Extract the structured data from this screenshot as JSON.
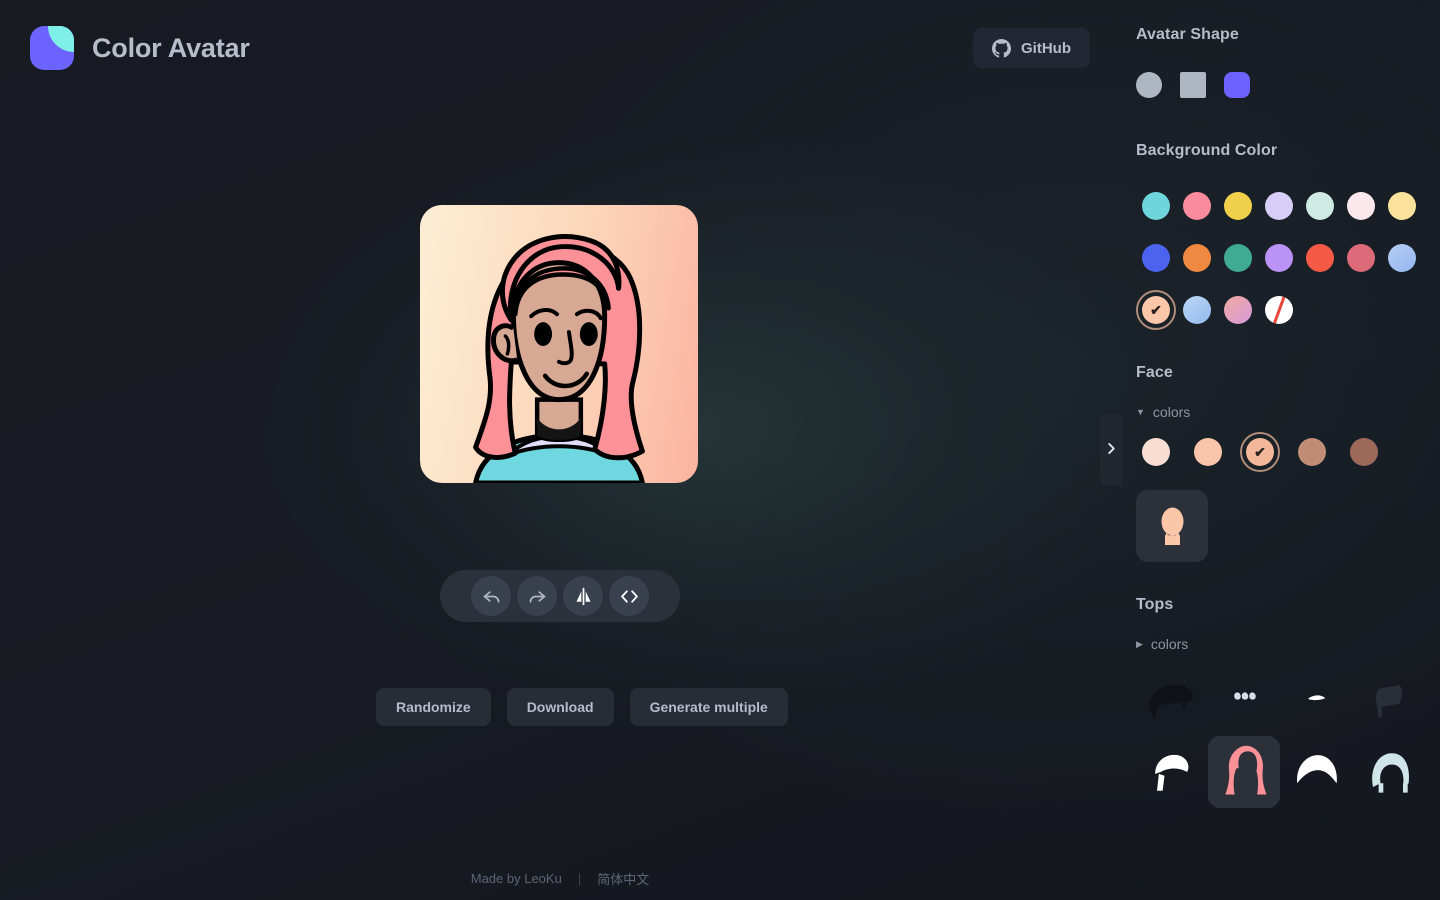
{
  "app": {
    "brand_title": "Color Avatar",
    "logo_colors": {
      "base": "#6c63ff",
      "accent": "#7ff0e8"
    },
    "background": "#16181f"
  },
  "header": {
    "github_label": "GitHub",
    "github_icon": "github-icon"
  },
  "stage": {
    "avatar": {
      "background_gradient_from": "#fdeed6",
      "background_gradient_to": "#fbb4a0",
      "hair_color": "#fc9298",
      "skin_color": "#d7a893",
      "top_color": "#6fd7e0",
      "collar_color": "#e3dcfb",
      "outline_color": "#000000"
    },
    "toolbar": [
      {
        "name": "undo-button",
        "icon": "undo-icon"
      },
      {
        "name": "redo-button",
        "icon": "redo-icon"
      },
      {
        "name": "flip-button",
        "icon": "flip-horizontal-icon"
      },
      {
        "name": "code-button",
        "icon": "code-icon"
      }
    ],
    "actions": [
      {
        "label": "Randomize",
        "name": "randomize-button"
      },
      {
        "label": "Download",
        "name": "download-button"
      },
      {
        "label": "Generate multiple",
        "name": "generate-multiple-button"
      }
    ]
  },
  "footer": {
    "made_by": "Made by LeoKu",
    "separator": "|",
    "language": "简体中文"
  },
  "sidebar": {
    "collapse_icon": "chevron-right-icon",
    "avatar_shape": {
      "title": "Avatar Shape",
      "options": [
        {
          "name": "shape-circle",
          "shape": "circle",
          "color": "#aeb6c2",
          "selected": false
        },
        {
          "name": "shape-square",
          "shape": "square",
          "color": "#aeb6c2",
          "selected": false
        },
        {
          "name": "shape-rounded",
          "shape": "rounded",
          "color": "#6c63ff",
          "selected": true
        }
      ]
    },
    "background_color": {
      "title": "Background Color",
      "swatches": [
        {
          "color": "#6dd5db",
          "selected": false
        },
        {
          "color": "#fa8b9c",
          "selected": false
        },
        {
          "color": "#f0cf4a",
          "selected": false
        },
        {
          "color": "#d7cdf7",
          "selected": false
        },
        {
          "color": "#cfe9e3",
          "selected": false
        },
        {
          "color": "#fbe8ec",
          "selected": false
        },
        {
          "color": "#fbe29a",
          "selected": false
        },
        {
          "color": "#4b63ef",
          "selected": false
        },
        {
          "color": "#ef8840",
          "selected": false
        },
        {
          "color": "#3fab93",
          "selected": false
        },
        {
          "color": "#bb92f5",
          "selected": false
        },
        {
          "color": "#f55a46",
          "selected": false
        },
        {
          "color": "#dc6a78",
          "selected": false
        },
        {
          "color": "#a9c0f2",
          "selected": false
        },
        {
          "color": "#fcc6a9",
          "selected": true
        },
        {
          "color": "#a8c8ee",
          "selected": false
        },
        {
          "color": "#e3a6d1",
          "selected": false
        },
        {
          "color": "none",
          "selected": false
        }
      ]
    },
    "face": {
      "title": "Face",
      "colors_label": "colors",
      "colors_expanded": true,
      "skin_swatches": [
        {
          "color": "#f8ddd0",
          "selected": false
        },
        {
          "color": "#fac5aa",
          "selected": false
        },
        {
          "color": "#f3b799",
          "selected": true
        },
        {
          "color": "#c08c75",
          "selected": false
        },
        {
          "color": "#9d6a5a",
          "selected": false
        }
      ],
      "thumbnails": [
        {
          "name": "face-shape-1",
          "selected": true,
          "color": "#fcc6a9"
        }
      ]
    },
    "tops": {
      "title": "Tops",
      "colors_label": "colors",
      "colors_expanded": false,
      "thumbnails": [
        {
          "name": "top-style-1",
          "selected": false,
          "color": "#101218",
          "style": "flat-dark"
        },
        {
          "name": "top-style-2",
          "selected": false,
          "color": "#d9dde6",
          "style": "curls"
        },
        {
          "name": "top-style-3",
          "selected": false,
          "color": "#ffffff",
          "style": "wisp"
        },
        {
          "name": "top-style-4",
          "selected": false,
          "color": "#2b3039",
          "style": "flag"
        },
        {
          "name": "top-style-5",
          "selected": false,
          "color": "#ffffff",
          "style": "cap"
        },
        {
          "name": "top-style-6",
          "selected": true,
          "color": "#fc9298",
          "style": "long-pink"
        },
        {
          "name": "top-style-7",
          "selected": false,
          "color": "#ffffff",
          "style": "bob"
        },
        {
          "name": "top-style-8",
          "selected": false,
          "color": "#cfe5e8",
          "style": "short-blue"
        }
      ]
    }
  }
}
